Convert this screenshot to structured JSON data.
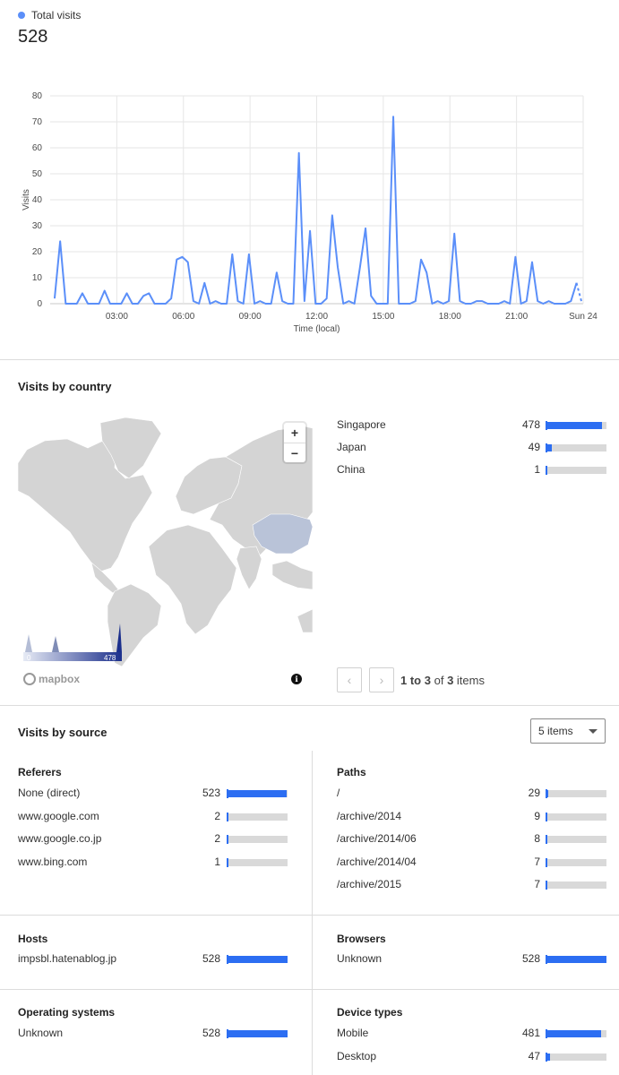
{
  "total_visits": {
    "legend_label": "Total visits",
    "value": "528",
    "series_color": "#5b8ff9"
  },
  "chart_data": {
    "type": "line",
    "xlabel": "Time (local)",
    "ylabel": "Visits",
    "ylim": [
      0,
      80
    ],
    "yticks": [
      "0",
      "10",
      "20",
      "30",
      "40",
      "50",
      "60",
      "70",
      "80"
    ],
    "xtick_labels": [
      "03:00",
      "06:00",
      "09:00",
      "12:00",
      "15:00",
      "18:00",
      "21:00",
      "Sun 24"
    ],
    "xtick_hours": [
      3,
      6,
      9,
      12,
      15,
      18,
      21,
      24
    ],
    "grid": true,
    "series": [
      {
        "x": [
          0,
          0.25,
          0.5,
          0.75,
          1,
          1.25,
          1.5,
          1.75,
          2,
          2.25,
          2.5,
          2.75,
          3,
          3.25,
          3.5,
          3.75,
          4,
          4.25,
          4.5,
          4.75,
          5,
          5.25,
          5.5,
          5.75,
          6,
          6.25,
          6.5,
          6.75,
          7,
          7.25,
          7.5,
          7.75,
          8,
          8.25,
          8.5,
          8.75,
          9,
          9.25,
          9.5,
          9.75,
          10,
          10.25,
          10.5,
          10.75,
          11,
          11.25,
          11.5,
          11.75,
          12,
          12.25,
          12.5,
          12.75,
          13,
          13.25,
          13.5,
          13.75,
          14,
          14.25,
          14.5,
          14.75,
          15,
          15.25,
          15.5,
          15.75,
          16,
          16.25,
          16.5,
          16.75,
          17,
          17.25,
          17.5,
          17.75,
          18,
          18.25,
          18.5,
          18.75,
          19,
          19.25,
          19.5,
          19.75,
          20,
          20.25,
          20.5,
          20.75,
          21,
          21.25,
          21.5,
          21.75,
          22,
          22.25,
          22.5,
          22.75,
          23,
          23.25,
          23.5,
          23.75
        ],
        "y": [
          2,
          24,
          0,
          0,
          0,
          4,
          0,
          0,
          0,
          5,
          0,
          0,
          0,
          4,
          0,
          0,
          3,
          4,
          0,
          0,
          0,
          2,
          17,
          18,
          16,
          1,
          0,
          8,
          0,
          1,
          0,
          0,
          19,
          1,
          0,
          19,
          0,
          1,
          0,
          0,
          12,
          1,
          0,
          0,
          58,
          1,
          28,
          0,
          0,
          2,
          34,
          14,
          0,
          1,
          0,
          14,
          29,
          3,
          0,
          0,
          0,
          72,
          0,
          0,
          0,
          1,
          17,
          12,
          0,
          1,
          0,
          1,
          27,
          1,
          0,
          0,
          1,
          1,
          0,
          0,
          0,
          1,
          0,
          18,
          0,
          1,
          16,
          1,
          0,
          1,
          0,
          0,
          0,
          1,
          8,
          0
        ]
      }
    ]
  },
  "country": {
    "title": "Visits by country",
    "items": [
      {
        "label": "Singapore",
        "value": "478",
        "fraction": 0.93
      },
      {
        "label": "Japan",
        "value": "49",
        "fraction": 0.1
      },
      {
        "label": "China",
        "value": "1",
        "fraction": 0.0
      }
    ],
    "map_scale_min": "0",
    "map_scale_max": "478",
    "map_attribution": "mapbox",
    "zoom_in": "+",
    "zoom_out": "−",
    "info_icon": "ℹ",
    "pager": {
      "range": "1 to 3",
      "of": "of",
      "total": "3",
      "unit": "items",
      "prev": "‹",
      "next": "›"
    }
  },
  "source": {
    "title": "Visits by source",
    "items_select": "5 items",
    "referers": {
      "title": "Referers",
      "items": [
        {
          "label": "None (direct)",
          "value": "523",
          "fraction": 0.99
        },
        {
          "label": "www.google.com",
          "value": "2",
          "fraction": 0.0
        },
        {
          "label": "www.google.co.jp",
          "value": "2",
          "fraction": 0.0
        },
        {
          "label": "www.bing.com",
          "value": "1",
          "fraction": 0.0
        }
      ]
    },
    "paths": {
      "title": "Paths",
      "items": [
        {
          "label": "/",
          "value": "29",
          "fraction": 0.05
        },
        {
          "label": "/archive/2014",
          "value": "9",
          "fraction": 0.0
        },
        {
          "label": "/archive/2014/06",
          "value": "8",
          "fraction": 0.0
        },
        {
          "label": "/archive/2014/04",
          "value": "7",
          "fraction": 0.0
        },
        {
          "label": "/archive/2015",
          "value": "7",
          "fraction": 0.0
        }
      ]
    },
    "hosts": {
      "title": "Hosts",
      "items": [
        {
          "label": "impsbl.hatenablog.jp",
          "value": "528",
          "fraction": 1.0
        }
      ]
    },
    "browsers": {
      "title": "Browsers",
      "items": [
        {
          "label": "Unknown",
          "value": "528",
          "fraction": 1.0
        }
      ]
    },
    "os": {
      "title": "Operating systems",
      "items": [
        {
          "label": "Unknown",
          "value": "528",
          "fraction": 1.0
        }
      ]
    },
    "devices": {
      "title": "Device types",
      "items": [
        {
          "label": "Mobile",
          "value": "481",
          "fraction": 0.91
        },
        {
          "label": "Desktop",
          "value": "47",
          "fraction": 0.07
        }
      ]
    }
  },
  "colors": {
    "bar_fill": "#2c6ef2",
    "bar_track": "#d9d9d9",
    "map_land": "#d4d4d4",
    "map_highlight": "#b9c3d8"
  }
}
